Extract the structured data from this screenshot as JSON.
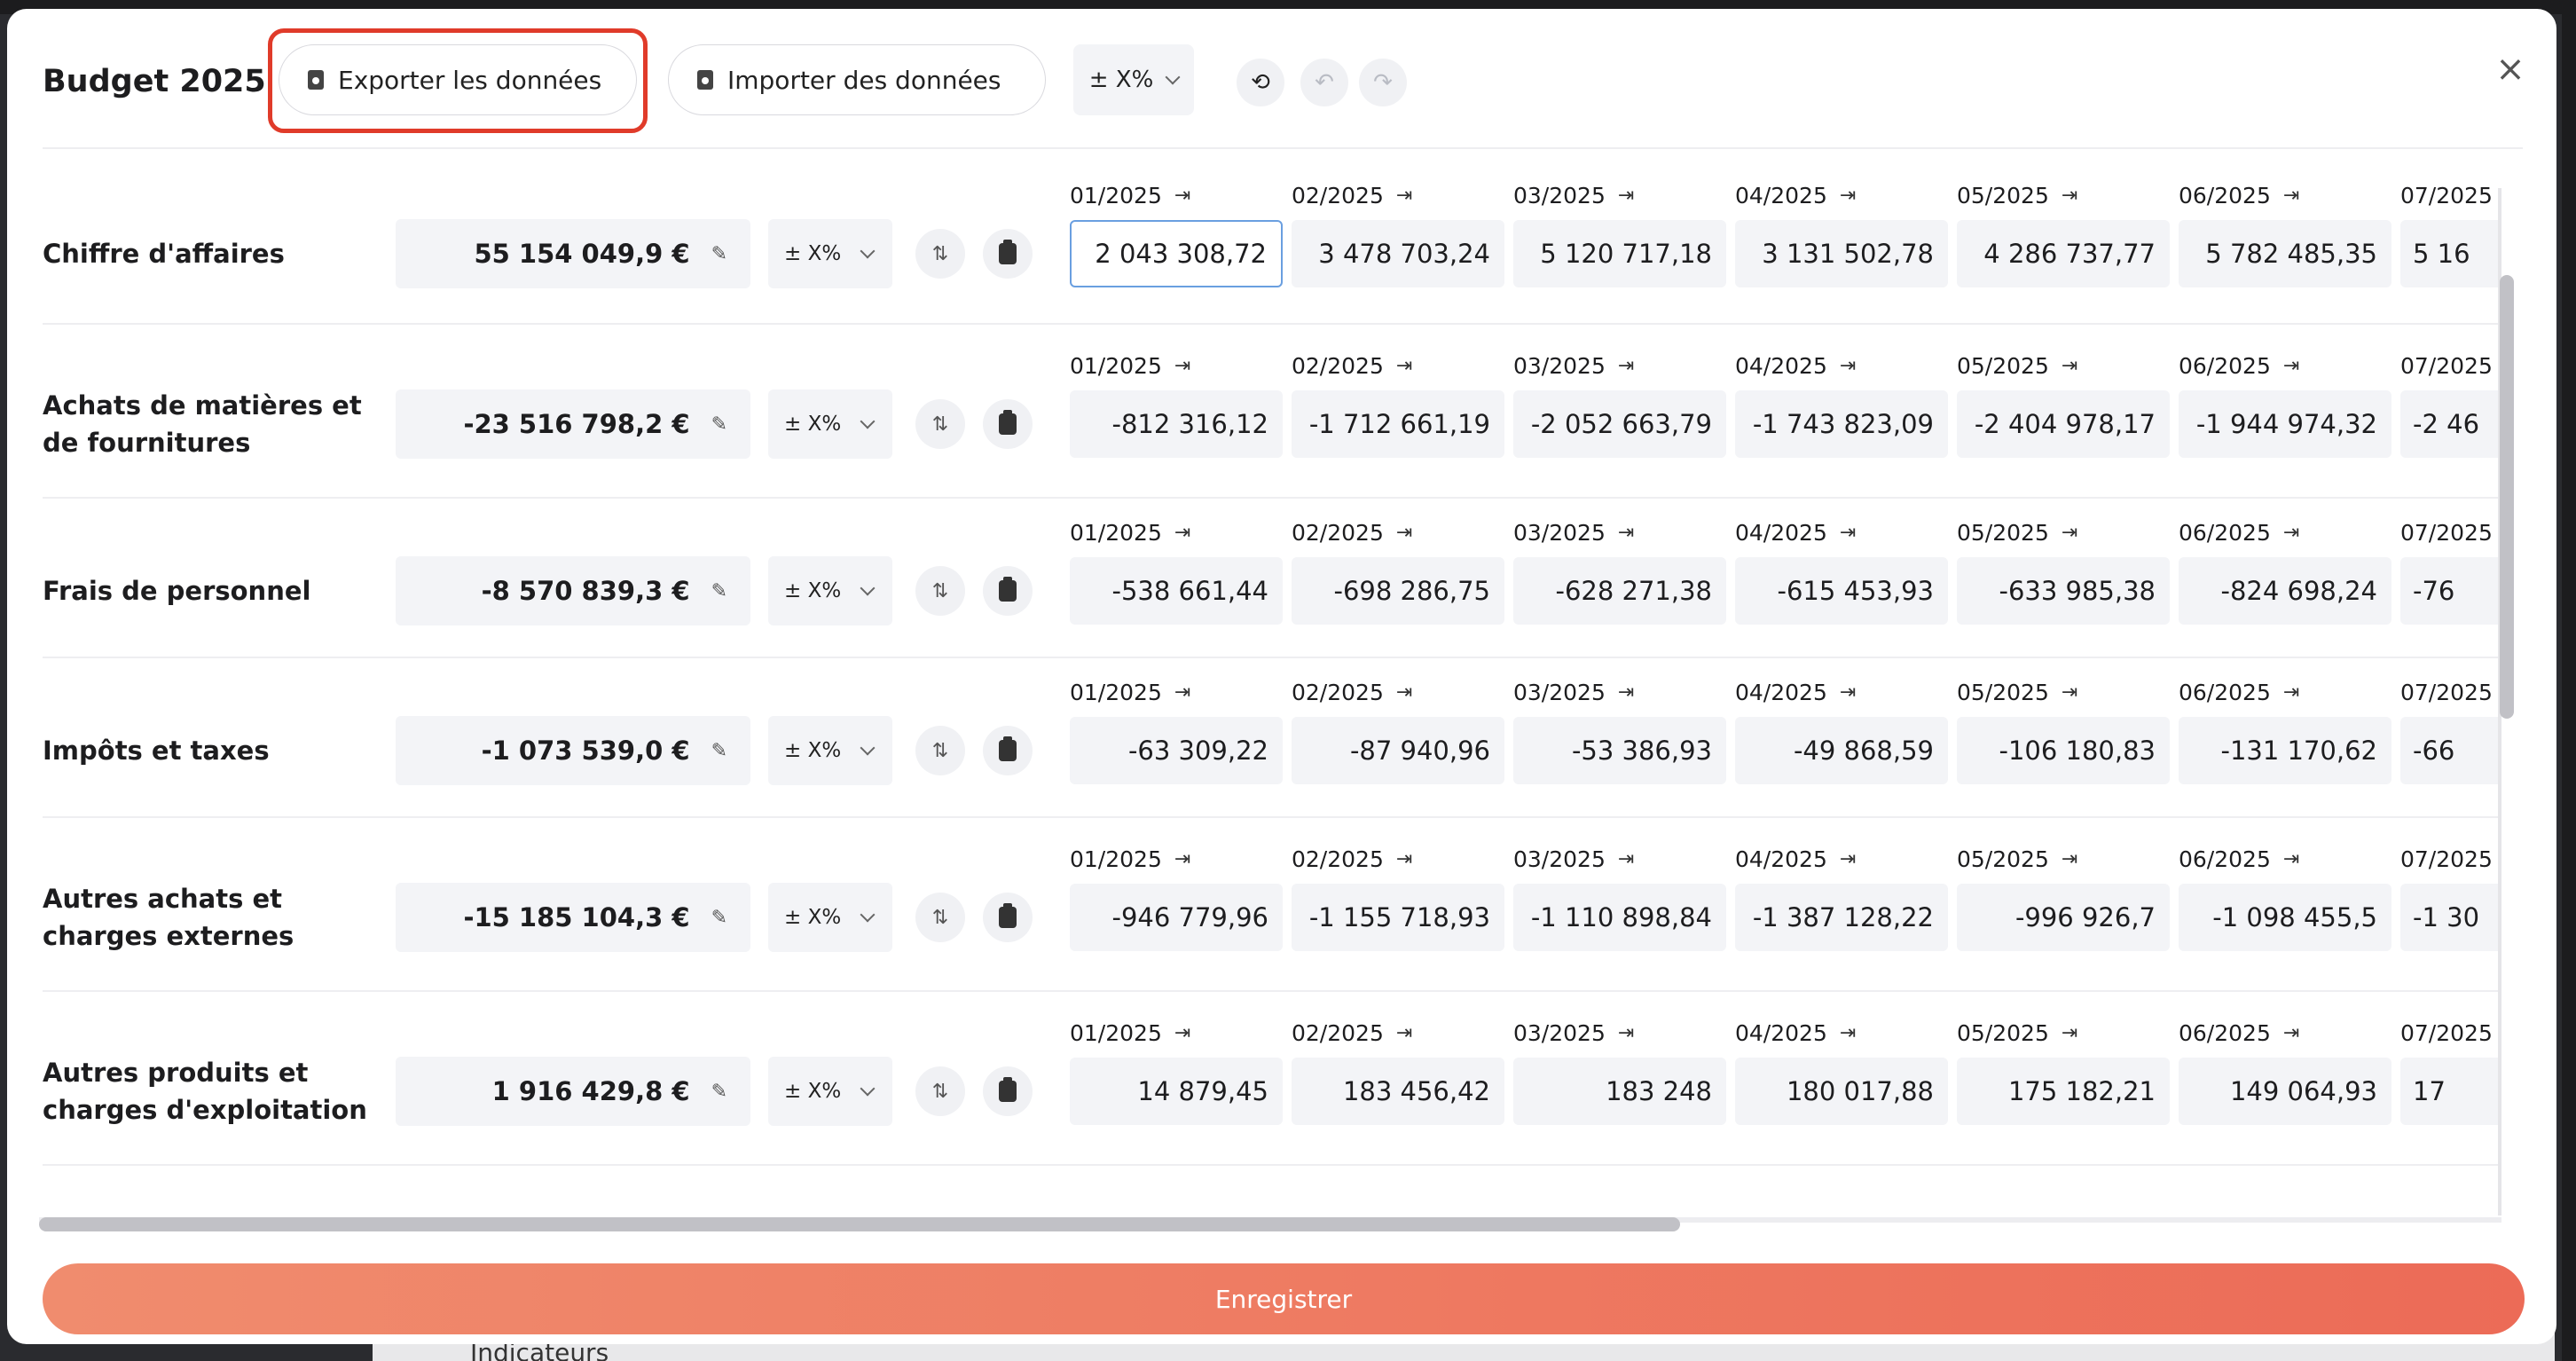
{
  "background": {
    "behind_text": "Indicateurs"
  },
  "header": {
    "title": "Budget 2025",
    "export_label": "Exporter les données",
    "import_label": "Importer des données",
    "pct_label": "± X%",
    "close": "×"
  },
  "row_pct_label": "± X%",
  "rows": [
    {
      "label": "Chiffre d'affaires",
      "total": "55 154 049,9 €",
      "months": [
        "01/2025",
        "02/2025",
        "03/2025",
        "04/2025",
        "05/2025",
        "06/2025",
        "07/2025"
      ],
      "values": [
        "2 043 308,72",
        "3 478 703,24",
        "5 120 717,18",
        "3 131 502,78",
        "4 286 737,77",
        "5 782 485,35",
        "5 16"
      ]
    },
    {
      "label": "Achats de matières et de fournitures",
      "total": "-23 516 798,2 €",
      "months": [
        "01/2025",
        "02/2025",
        "03/2025",
        "04/2025",
        "05/2025",
        "06/2025",
        "07/2025"
      ],
      "values": [
        "-812 316,12",
        "-1 712 661,19",
        "-2 052 663,79",
        "-1 743 823,09",
        "-2 404 978,17",
        "-1 944 974,32",
        "-2 46"
      ]
    },
    {
      "label": "Frais de personnel",
      "total": "-8 570 839,3 €",
      "months": [
        "01/2025",
        "02/2025",
        "03/2025",
        "04/2025",
        "05/2025",
        "06/2025",
        "07/2025"
      ],
      "values": [
        "-538 661,44",
        "-698 286,75",
        "-628 271,38",
        "-615 453,93",
        "-633 985,38",
        "-824 698,24",
        "-76"
      ]
    },
    {
      "label": "Impôts et taxes",
      "total": "-1 073 539,0 €",
      "months": [
        "01/2025",
        "02/2025",
        "03/2025",
        "04/2025",
        "05/2025",
        "06/2025",
        "07/2025"
      ],
      "values": [
        "-63 309,22",
        "-87 940,96",
        "-53 386,93",
        "-49 868,59",
        "-106 180,83",
        "-131 170,62",
        "-66"
      ]
    },
    {
      "label": "Autres achats et charges externes",
      "total": "-15 185 104,3 €",
      "months": [
        "01/2025",
        "02/2025",
        "03/2025",
        "04/2025",
        "05/2025",
        "06/2025",
        "07/2025"
      ],
      "values": [
        "-946 779,96",
        "-1 155 718,93",
        "-1 110 898,84",
        "-1 387 128,22",
        "-996 926,7",
        "-1 098 455,5",
        "-1 30"
      ]
    },
    {
      "label": "Autres produits et charges d'exploitation",
      "total": "1 916 429,8 €",
      "months": [
        "01/2025",
        "02/2025",
        "03/2025",
        "04/2025",
        "05/2025",
        "06/2025",
        "07/2025"
      ],
      "values": [
        "14 879,45",
        "183 456,42",
        "183 248",
        "180 017,88",
        "175 182,21",
        "149 064,93",
        "17"
      ]
    }
  ],
  "save_label": "Enregistrer"
}
